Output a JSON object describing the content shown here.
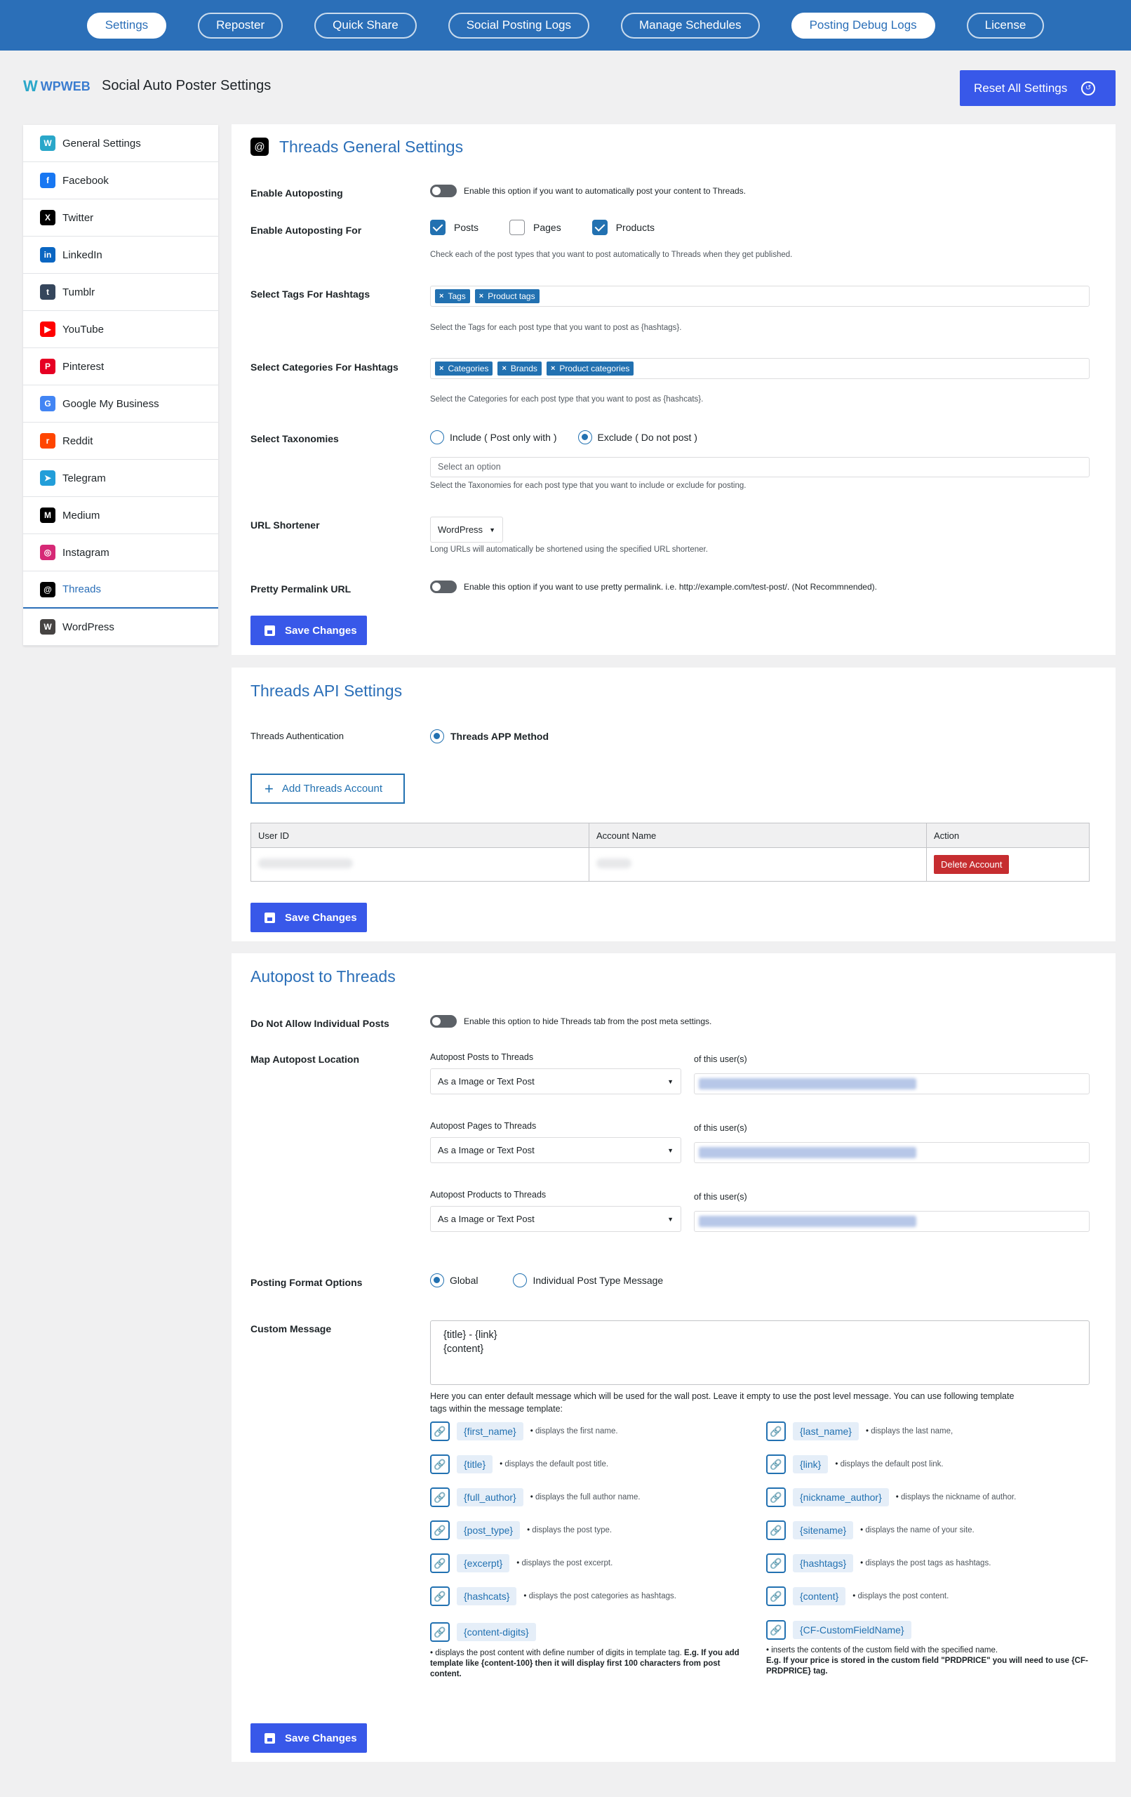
{
  "topnav": [
    "Settings",
    "Reposter",
    "Quick Share",
    "Social Posting Logs",
    "Manage Schedules",
    "Posting Debug Logs",
    "License"
  ],
  "header": {
    "logo_w": "W",
    "logo_text": "WPWEB",
    "title": "Social Auto Poster Settings",
    "reset_label": "Reset All Settings"
  },
  "sidebar": {
    "items": [
      {
        "label": "General Settings",
        "icon": "wpweb-icon",
        "color": "#2aa7c9",
        "glyph": "W"
      },
      {
        "label": "Facebook",
        "icon": "facebook-icon",
        "color": "#1877f2",
        "glyph": "f"
      },
      {
        "label": "Twitter",
        "icon": "x-icon",
        "color": "#000000",
        "glyph": "X"
      },
      {
        "label": "LinkedIn",
        "icon": "linkedin-icon",
        "color": "#0a66c2",
        "glyph": "in"
      },
      {
        "label": "Tumblr",
        "icon": "tumblr-icon",
        "color": "#35465c",
        "glyph": "t"
      },
      {
        "label": "YouTube",
        "icon": "youtube-icon",
        "color": "#ff0000",
        "glyph": "▶"
      },
      {
        "label": "Pinterest",
        "icon": "pinterest-icon",
        "color": "#e60023",
        "glyph": "P"
      },
      {
        "label": "Google My Business",
        "icon": "google-my-business-icon",
        "color": "#4285f4",
        "glyph": "G"
      },
      {
        "label": "Reddit",
        "icon": "reddit-icon",
        "color": "#ff4500",
        "glyph": "r"
      },
      {
        "label": "Telegram",
        "icon": "telegram-icon",
        "color": "#229ed9",
        "glyph": "➤"
      },
      {
        "label": "Medium",
        "icon": "medium-icon",
        "color": "#000000",
        "glyph": "M"
      },
      {
        "label": "Instagram",
        "icon": "instagram-icon",
        "color": "#d62976",
        "glyph": "◎"
      },
      {
        "label": "Threads",
        "icon": "threads-icon",
        "color": "#000000",
        "glyph": "@"
      },
      {
        "label": "WordPress",
        "icon": "wordpress-icon",
        "color": "#464342",
        "glyph": "W"
      }
    ]
  },
  "general": {
    "title": "Threads General Settings",
    "enable_autoposting_label": "Enable Autoposting",
    "enable_autoposting_desc": "Enable this option if you want to automatically post your content to Threads.",
    "autoposting_for_label": "Enable Autoposting For",
    "pt_posts": "Posts",
    "pt_pages": "Pages",
    "pt_products": "Products",
    "autoposting_for_desc": "Check each of the post types that you want to post automatically to Threads when they get published.",
    "tags_label": "Select Tags For Hashtags",
    "tags": [
      "Tags",
      "Product tags"
    ],
    "tags_desc": "Select the Tags for each post type that you want to post as {hashtags}.",
    "cats_label": "Select Categories For Hashtags",
    "cats": [
      "Categories",
      "Brands",
      "Product categories"
    ],
    "cats_desc": "Select the Categories for each post type that you want to post as {hashcats}.",
    "tax_label": "Select Taxonomies",
    "tax_include": "Include ( Post only with )",
    "tax_exclude": "Exclude ( Do not post )",
    "tax_placeholder": "Select an option",
    "tax_desc": "Select the Taxonomies for each post type that you want to include or exclude for posting.",
    "url_label": "URL Shortener",
    "url_value": "WordPress",
    "url_desc": "Long URLs will automatically be shortened using the specified URL shortener.",
    "pretty_label": "Pretty Permalink URL",
    "pretty_desc": "Enable this option if you want to use pretty permalink. i.e. http://example.com/test-post/. (Not Recommnended).",
    "save": "Save Changes"
  },
  "api": {
    "title": "Threads API Settings",
    "auth_label": "Threads Authentication",
    "auth_method": "Threads APP Method",
    "add_account": "Add Threads Account",
    "columns": [
      "User ID",
      "Account Name",
      "Action"
    ],
    "delete": "Delete Account",
    "save": "Save Changes"
  },
  "autopost": {
    "title": "Autopost to Threads",
    "no_individual_label": "Do Not Allow Individual Posts",
    "no_individual_desc": "Enable this option to hide Threads tab from the post meta settings.",
    "map_label": "Map Autopost Location",
    "maps": [
      {
        "label": "Autopost Posts to Threads",
        "value": "As a Image or Text Post",
        "user_label": "of this user(s)"
      },
      {
        "label": "Autopost Pages to Threads",
        "value": "As a Image or Text Post",
        "user_label": "of this user(s)"
      },
      {
        "label": "Autopost Products to Threads",
        "value": "As a Image or Text Post",
        "user_label": "of this user(s)"
      }
    ],
    "format_label": "Posting Format Options",
    "format_global": "Global",
    "format_individual": "Individual Post Type Message",
    "custom_label": "Custom Message",
    "custom_line1": "{title} - {link}",
    "custom_line2": "{content}",
    "custom_desc1": "Here you can enter default message which will be used for the wall post. Leave it empty to use the post level message. You can use following template",
    "custom_desc2": "tags within the message template:",
    "tokens_left": [
      {
        "tag": "{first_name}",
        "desc": "displays the first name."
      },
      {
        "tag": "{title}",
        "desc": "displays the default post title."
      },
      {
        "tag": "{full_author}",
        "desc": "displays the full author name."
      },
      {
        "tag": "{post_type}",
        "desc": "displays the post type."
      },
      {
        "tag": "{excerpt}",
        "desc": "displays the post excerpt."
      },
      {
        "tag": "{hashcats}",
        "desc": "displays the post categories as hashtags."
      }
    ],
    "tokens_right": [
      {
        "tag": "{last_name}",
        "desc": "displays the last name,"
      },
      {
        "tag": "{link}",
        "desc": "displays the default post link."
      },
      {
        "tag": "{nickname_author}",
        "desc": "displays the nickname of author."
      },
      {
        "tag": "{sitename}",
        "desc": "displays the name of your site."
      },
      {
        "tag": "{hashtags}",
        "desc": "displays the post tags as hashtags."
      },
      {
        "tag": "{content}",
        "desc": "displays the post content."
      }
    ],
    "digits_tag": "{content-digits}",
    "digits_desc_a": "displays the post content with define number of digits in template tag.",
    "digits_desc_b": "E.g. If you add template like {content-100} then it will display first 100 characters from post content.",
    "cf_tag": "{CF-CustomFieldName}",
    "cf_desc_a": "inserts the contents of the custom field with the specified name.",
    "cf_desc_b": "E.g. If your price is stored in the custom field \"PRDPRICE\" you will need to use {CF-PRDPRICE} tag.",
    "save": "Save Changes"
  }
}
